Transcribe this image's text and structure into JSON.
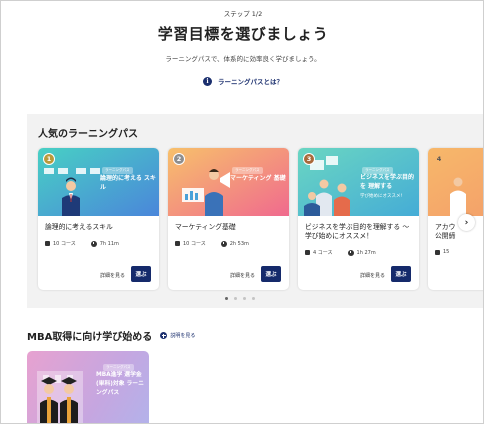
{
  "header": {
    "step": "ステップ 1/2",
    "title": "学習目標を選びましょう",
    "subtitle": "ラーニングパスで、体系的に効率良く学びましょう。",
    "whatis_link": "ラーニングパスとは？"
  },
  "popular": {
    "title": "人気のラーニングパス",
    "cards": [
      {
        "rank": "1",
        "rank_color": "#b99a3b",
        "tag": "ラーニングパス",
        "thumb_text": "論理的に考える スキル",
        "name": "論理的に考えるスキル",
        "courses": "10 コース",
        "duration": "7h 11m",
        "details": "詳細を見る",
        "choose": "選ぶ"
      },
      {
        "rank": "2",
        "rank_color": "#8e8e8e",
        "tag": "ラーニングパス",
        "thumb_text": "マーケティング 基礎",
        "name": "マーケティング基礎",
        "courses": "10 コース",
        "duration": "2h 53m",
        "details": "詳細を見る",
        "choose": "選ぶ"
      },
      {
        "rank": "3",
        "rank_color": "#a86a3a",
        "tag": "ラーニングパス",
        "thumb_text": "ビジネスを学ぶ目的を 理解する",
        "sub": "学び始めにオススメ!",
        "name": "ビジネスを学ぶ目的を理解する ～学び始めにオススメ！",
        "courses": "4 コース",
        "duration": "1h 27m",
        "details": "詳細を見る",
        "choose": "選ぶ"
      },
      {
        "rank": "4",
        "rank_color": "#ffffff",
        "name": "アカウ 公開締",
        "courses": "15"
      }
    ],
    "next_icon": "chevron-right-icon"
  },
  "mba": {
    "title": "MBA取得に向け学び始める",
    "link": "説明を見る",
    "card": {
      "tag": "ラーニングパス",
      "thumb_text": "MBA進学 選学金(単科)対象 ラーニングパス"
    }
  },
  "colors": {
    "primary": "#152a6b",
    "card1_gradient": [
      "#3fc5c9",
      "#4a8ed8"
    ],
    "card2_gradient": [
      "#f6b36a",
      "#f06b8a"
    ],
    "card3_gradient": [
      "#5fd0c6",
      "#4bb0d8"
    ]
  }
}
